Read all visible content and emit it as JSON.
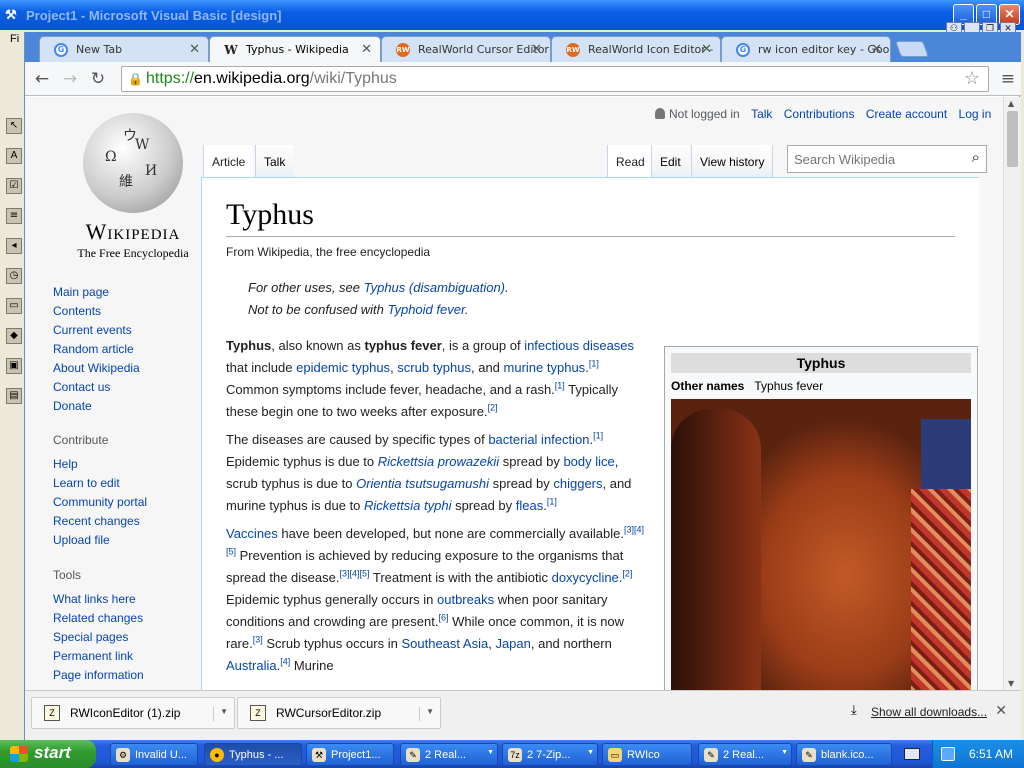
{
  "vb_window": {
    "title": "Project1 - Microsoft Visual Basic [design]",
    "menu_first": "Fi"
  },
  "tabs": [
    {
      "title": "New Tab",
      "favicon": "google-icon"
    },
    {
      "title": "Typhus - Wikipedia",
      "favicon": "wikipedia-icon"
    },
    {
      "title": "RealWorld Cursor Editor",
      "favicon": "realworld-icon"
    },
    {
      "title": "RealWorld Icon Editor - ",
      "favicon": "realworld-icon"
    },
    {
      "title": "rw icon editor key - Goo",
      "favicon": "google-icon"
    }
  ],
  "address": {
    "scheme": "https://",
    "host": "en.wikipedia.org",
    "path": "/wiki/Typhus"
  },
  "wiki": {
    "wordmark": "Wikipedia",
    "tagline": "The Free Encyclopedia",
    "nav": [
      "Main page",
      "Contents",
      "Current events",
      "Random article",
      "About Wikipedia",
      "Contact us",
      "Donate"
    ],
    "contribute_heading": "Contribute",
    "contribute": [
      "Help",
      "Learn to edit",
      "Community portal",
      "Recent changes",
      "Upload file"
    ],
    "tools_heading": "Tools",
    "tools": [
      "What links here",
      "Related changes",
      "Special pages",
      "Permanent link",
      "Page information"
    ],
    "personal": {
      "not_logged_in": "Not logged in",
      "talk": "Talk",
      "contributions": "Contributions",
      "create_account": "Create account",
      "log_in": "Log in"
    },
    "tabs": {
      "article": "Article",
      "talk": "Talk",
      "read": "Read",
      "edit": "Edit",
      "history": "View history"
    },
    "search_placeholder": "Search Wikipedia",
    "article": {
      "title": "Typhus",
      "from": "From Wikipedia, the free encyclopedia",
      "hatnote1_prefix": "For other uses, see ",
      "hatnote1_link": "Typhus (disambiguation)",
      "hatnote1_suffix": ".",
      "hatnote2_prefix": "Not to be confused with ",
      "hatnote2_link": "Typhoid fever",
      "hatnote2_suffix": ".",
      "p1": {
        "t1": "Typhus",
        "t2": ", also known as ",
        "t3": "typhus fever",
        "t4": ", is a group of ",
        "l1": "infectious diseases",
        "t5": " that include ",
        "l2": "epidemic typhus",
        "t6": ", ",
        "l3": "scrub typhus",
        "t7": ", and ",
        "l4": "murine typhus",
        "t8": ".",
        "r1": "[1]",
        "t9": " Common symptoms include fever, headache, and a rash.",
        "r2": "[1]",
        "t10": " Typically these begin one to two weeks after exposure.",
        "r3": "[2]"
      },
      "p2": {
        "t1": "The diseases are caused by specific types of ",
        "l1": "bacterial infection",
        "t2": ".",
        "r1": "[1]",
        "t3": " Epidemic typhus is due to ",
        "l2": "Rickettsia prowazekii",
        "t4": " spread by ",
        "l3": "body lice",
        "t5": ", scrub typhus is due to ",
        "l4": "Orientia tsutsugamushi",
        "t6": " spread by ",
        "l5": "chiggers",
        "t7": ", and murine typhus is due to ",
        "l6": "Rickettsia typhi",
        "t8": " spread by ",
        "l7": "fleas",
        "t9": ".",
        "r2": "[1]"
      },
      "p3": {
        "l1": "Vaccines",
        "t1": " have been developed, but none are commercially available.",
        "r1": "[3][4][5]",
        "t2": " Prevention is achieved by reducing exposure to the organisms that spread the disease.",
        "r2": "[3][4][5]",
        "t3": " Treatment is with the antibiotic ",
        "l2": "doxycycline",
        "t4": ".",
        "r3": "[2]",
        "t5": " Epidemic typhus generally occurs in ",
        "l3": "outbreaks",
        "t6": " when poor sanitary conditions and crowding are present.",
        "r4": "[6]",
        "t7": " While once common, it is now rare.",
        "r5": "[3]",
        "t8": " Scrub typhus occurs in ",
        "l4": "Southeast Asia",
        "t9": ", ",
        "l5": "Japan",
        "t10": ", and northern ",
        "l6": "Australia",
        "t11": ".",
        "r6": "[4]",
        "t12": " Murine"
      }
    },
    "infobox": {
      "title": "Typhus",
      "label": "Other names",
      "value": "Typhus fever"
    }
  },
  "downloads": {
    "items": [
      "RWIconEditor (1).zip",
      "RWCursorEditor.zip"
    ],
    "show_all": "Show all downloads..."
  },
  "taskbar": {
    "start": "start",
    "tasks": [
      "Invalid U...",
      "Typhus - ...",
      "Project1...",
      "2 Real...",
      "2 7-Zip...",
      "RWIco",
      "2 Real...",
      "blank.ico..."
    ],
    "clock": "6:51 AM"
  }
}
